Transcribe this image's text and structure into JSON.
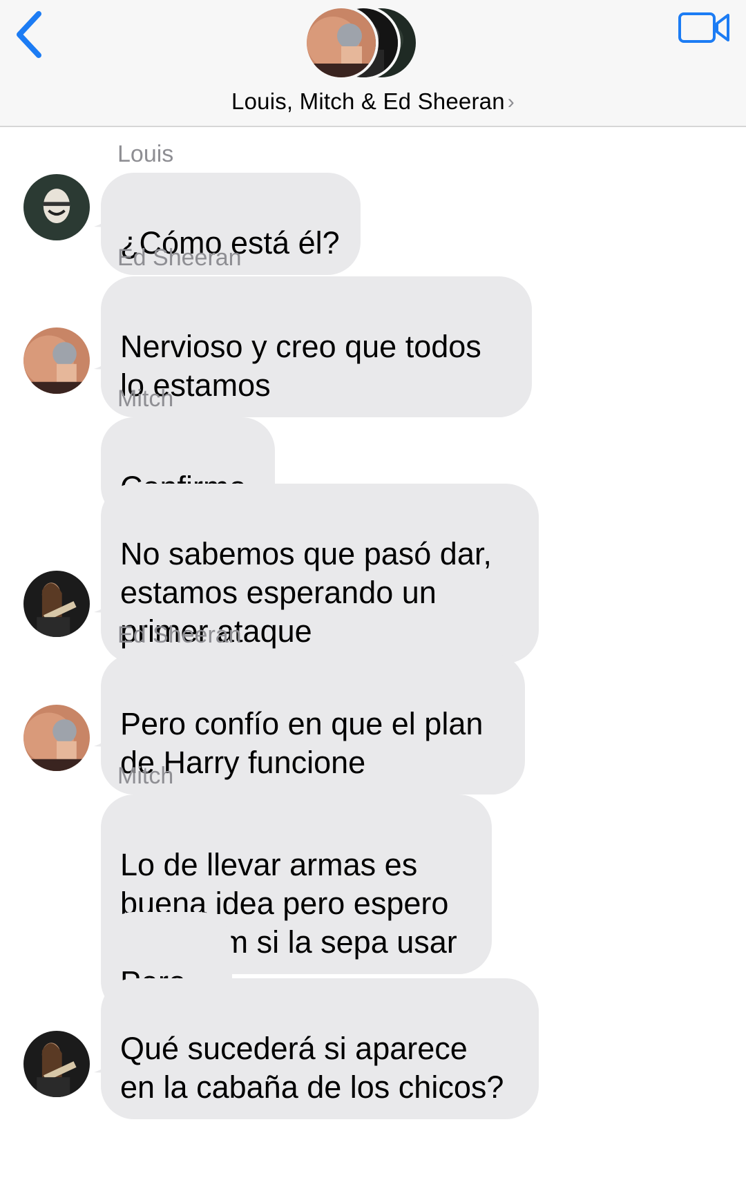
{
  "header": {
    "chat_title": "Louis, Mitch & Ed Sheeran",
    "chevron": "›",
    "back_icon": "chevron-left-icon",
    "video_icon": "video-camera-icon",
    "accent": "#1c7cf4"
  },
  "messages": [
    {
      "sender": "Louis",
      "text": "¿Cómo está él?"
    },
    {
      "sender": "Ed Sheeran",
      "text": "Nervioso y creo que todos\nlo estamos"
    },
    {
      "sender": "Mitch",
      "text": "Confirmo"
    },
    {
      "text": "No sabemos que pasó dar,\nestamos esperando un\nprimer ataque"
    },
    {
      "sender": "Ed Sheeran",
      "text": "Pero confío en que el plan\nde Harry funcione"
    },
    {
      "sender": "Mitch",
      "text": "Lo de llevar armas es\nbuena idea pero espero\nque Liam si la sepa usar"
    },
    {
      "text": "Pero..."
    },
    {
      "text": "Qué sucederá si aparece\nen la cabaña de los chicos?"
    }
  ]
}
